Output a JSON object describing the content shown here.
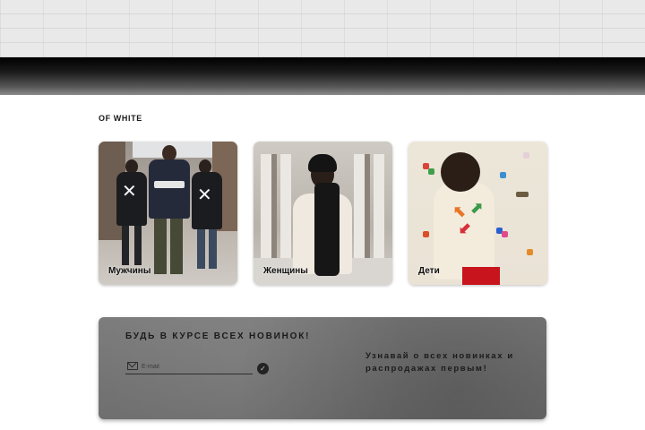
{
  "section": {
    "title": "OF WHITE"
  },
  "categories": [
    {
      "label": "Мужчины"
    },
    {
      "label": "Женщины"
    },
    {
      "label": "Дети"
    }
  ],
  "newsletter": {
    "title": "БУДЬ В КУРСЕ ВСЕХ НОВИНОК!",
    "email_placeholder": "E-mail",
    "submit_icon": "check-icon",
    "side_text": "Узнавай о всех новинках и распродажах первым!"
  },
  "colors": {
    "hero_band": "#000000",
    "newsletter_bg": "#737373",
    "kids_pants": "#c8141c"
  }
}
